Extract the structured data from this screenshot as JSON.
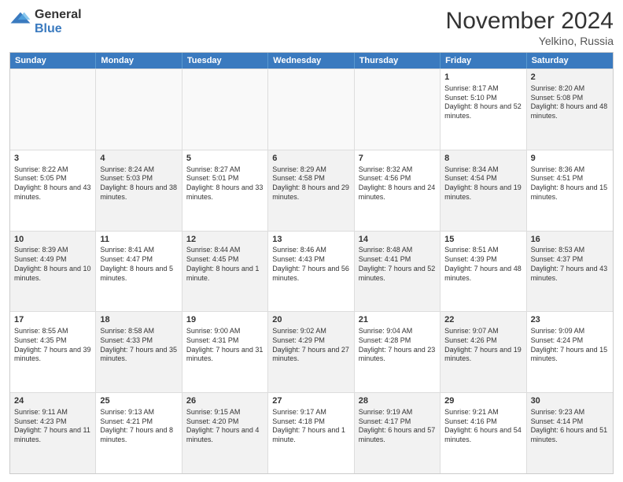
{
  "logo": {
    "general": "General",
    "blue": "Blue"
  },
  "header": {
    "month": "November 2024",
    "location": "Yelkino, Russia"
  },
  "weekdays": [
    "Sunday",
    "Monday",
    "Tuesday",
    "Wednesday",
    "Thursday",
    "Friday",
    "Saturday"
  ],
  "rows": [
    [
      {
        "day": "",
        "text": "",
        "empty": true
      },
      {
        "day": "",
        "text": "",
        "empty": true
      },
      {
        "day": "",
        "text": "",
        "empty": true
      },
      {
        "day": "",
        "text": "",
        "empty": true
      },
      {
        "day": "",
        "text": "",
        "empty": true
      },
      {
        "day": "1",
        "text": "Sunrise: 8:17 AM\nSunset: 5:10 PM\nDaylight: 8 hours and 52 minutes."
      },
      {
        "day": "2",
        "text": "Sunrise: 8:20 AM\nSunset: 5:08 PM\nDaylight: 8 hours and 48 minutes.",
        "shaded": true
      }
    ],
    [
      {
        "day": "3",
        "text": "Sunrise: 8:22 AM\nSunset: 5:05 PM\nDaylight: 8 hours and 43 minutes."
      },
      {
        "day": "4",
        "text": "Sunrise: 8:24 AM\nSunset: 5:03 PM\nDaylight: 8 hours and 38 minutes.",
        "shaded": true
      },
      {
        "day": "5",
        "text": "Sunrise: 8:27 AM\nSunset: 5:01 PM\nDaylight: 8 hours and 33 minutes."
      },
      {
        "day": "6",
        "text": "Sunrise: 8:29 AM\nSunset: 4:58 PM\nDaylight: 8 hours and 29 minutes.",
        "shaded": true
      },
      {
        "day": "7",
        "text": "Sunrise: 8:32 AM\nSunset: 4:56 PM\nDaylight: 8 hours and 24 minutes."
      },
      {
        "day": "8",
        "text": "Sunrise: 8:34 AM\nSunset: 4:54 PM\nDaylight: 8 hours and 19 minutes.",
        "shaded": true
      },
      {
        "day": "9",
        "text": "Sunrise: 8:36 AM\nSunset: 4:51 PM\nDaylight: 8 hours and 15 minutes."
      }
    ],
    [
      {
        "day": "10",
        "text": "Sunrise: 8:39 AM\nSunset: 4:49 PM\nDaylight: 8 hours and 10 minutes.",
        "shaded": true
      },
      {
        "day": "11",
        "text": "Sunrise: 8:41 AM\nSunset: 4:47 PM\nDaylight: 8 hours and 5 minutes."
      },
      {
        "day": "12",
        "text": "Sunrise: 8:44 AM\nSunset: 4:45 PM\nDaylight: 8 hours and 1 minute.",
        "shaded": true
      },
      {
        "day": "13",
        "text": "Sunrise: 8:46 AM\nSunset: 4:43 PM\nDaylight: 7 hours and 56 minutes."
      },
      {
        "day": "14",
        "text": "Sunrise: 8:48 AM\nSunset: 4:41 PM\nDaylight: 7 hours and 52 minutes.",
        "shaded": true
      },
      {
        "day": "15",
        "text": "Sunrise: 8:51 AM\nSunset: 4:39 PM\nDaylight: 7 hours and 48 minutes."
      },
      {
        "day": "16",
        "text": "Sunrise: 8:53 AM\nSunset: 4:37 PM\nDaylight: 7 hours and 43 minutes.",
        "shaded": true
      }
    ],
    [
      {
        "day": "17",
        "text": "Sunrise: 8:55 AM\nSunset: 4:35 PM\nDaylight: 7 hours and 39 minutes."
      },
      {
        "day": "18",
        "text": "Sunrise: 8:58 AM\nSunset: 4:33 PM\nDaylight: 7 hours and 35 minutes.",
        "shaded": true
      },
      {
        "day": "19",
        "text": "Sunrise: 9:00 AM\nSunset: 4:31 PM\nDaylight: 7 hours and 31 minutes."
      },
      {
        "day": "20",
        "text": "Sunrise: 9:02 AM\nSunset: 4:29 PM\nDaylight: 7 hours and 27 minutes.",
        "shaded": true
      },
      {
        "day": "21",
        "text": "Sunrise: 9:04 AM\nSunset: 4:28 PM\nDaylight: 7 hours and 23 minutes."
      },
      {
        "day": "22",
        "text": "Sunrise: 9:07 AM\nSunset: 4:26 PM\nDaylight: 7 hours and 19 minutes.",
        "shaded": true
      },
      {
        "day": "23",
        "text": "Sunrise: 9:09 AM\nSunset: 4:24 PM\nDaylight: 7 hours and 15 minutes."
      }
    ],
    [
      {
        "day": "24",
        "text": "Sunrise: 9:11 AM\nSunset: 4:23 PM\nDaylight: 7 hours and 11 minutes.",
        "shaded": true
      },
      {
        "day": "25",
        "text": "Sunrise: 9:13 AM\nSunset: 4:21 PM\nDaylight: 7 hours and 8 minutes."
      },
      {
        "day": "26",
        "text": "Sunrise: 9:15 AM\nSunset: 4:20 PM\nDaylight: 7 hours and 4 minutes.",
        "shaded": true
      },
      {
        "day": "27",
        "text": "Sunrise: 9:17 AM\nSunset: 4:18 PM\nDaylight: 7 hours and 1 minute."
      },
      {
        "day": "28",
        "text": "Sunrise: 9:19 AM\nSunset: 4:17 PM\nDaylight: 6 hours and 57 minutes.",
        "shaded": true
      },
      {
        "day": "29",
        "text": "Sunrise: 9:21 AM\nSunset: 4:16 PM\nDaylight: 6 hours and 54 minutes."
      },
      {
        "day": "30",
        "text": "Sunrise: 9:23 AM\nSunset: 4:14 PM\nDaylight: 6 hours and 51 minutes.",
        "shaded": true
      }
    ]
  ]
}
